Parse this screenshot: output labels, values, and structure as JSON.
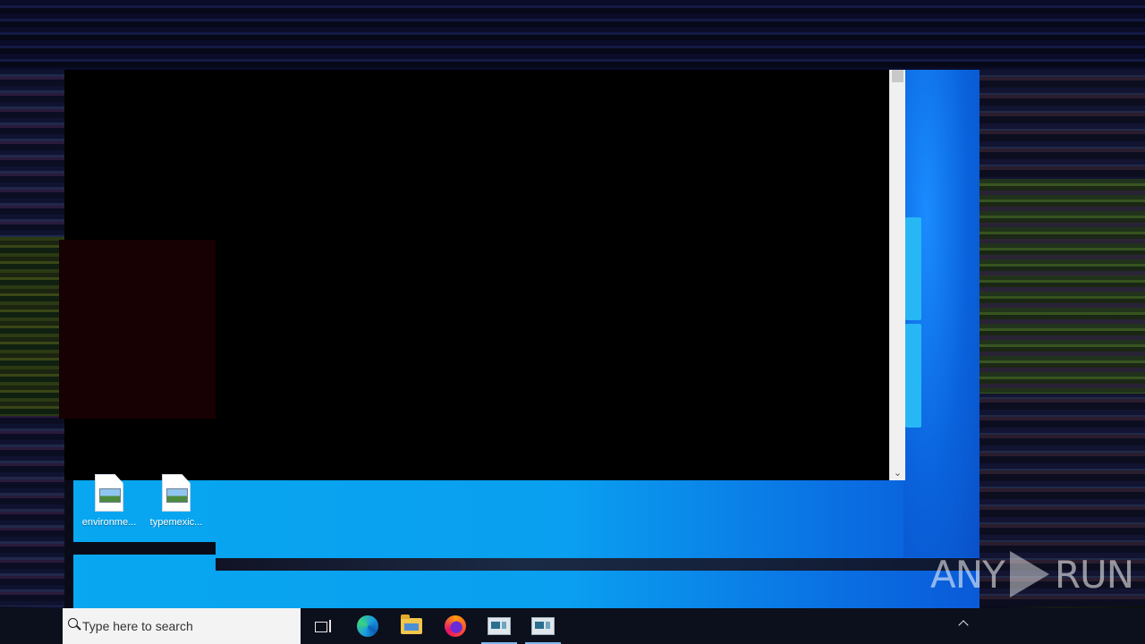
{
  "desktop": {
    "icons": [
      {
        "label": "environme...",
        "icon": "image-file-icon"
      },
      {
        "label": "typemexic...",
        "icon": "image-file-icon"
      }
    ]
  },
  "console": {
    "scroll_down_glyph": "⌄"
  },
  "watermark": {
    "left": "ANY",
    "right": "RUN"
  },
  "taskbar": {
    "search_placeholder": "Type here to search",
    "apps": [
      {
        "name": "task-view",
        "icon": "task-view-icon"
      },
      {
        "name": "edge",
        "icon": "edge-icon"
      },
      {
        "name": "file-explorer",
        "icon": "folder-icon"
      },
      {
        "name": "firefox",
        "icon": "firefox-icon"
      },
      {
        "name": "app-window-1",
        "icon": "app-window-icon"
      },
      {
        "name": "app-window-2",
        "icon": "app-window-icon"
      }
    ],
    "tray_chevron": "show-hidden-icons"
  },
  "colors": {
    "wallpaper_blue": "#08a7f0",
    "taskbar": "#0c0f1c",
    "console_bg": "#000000"
  }
}
